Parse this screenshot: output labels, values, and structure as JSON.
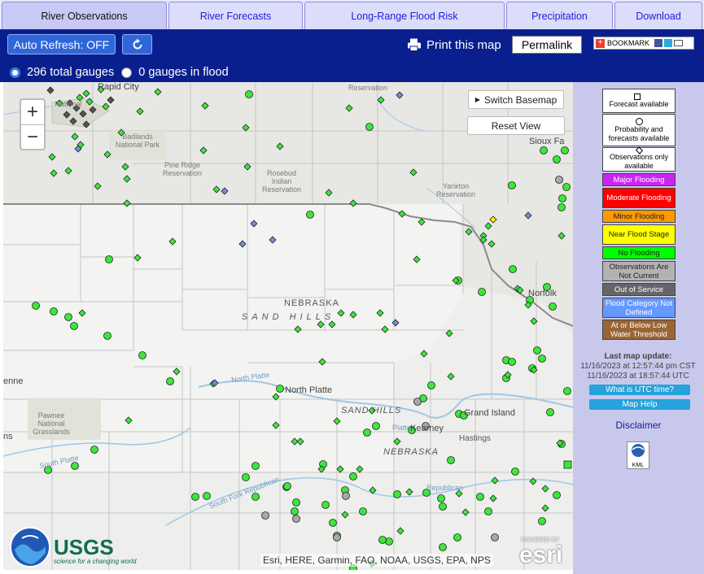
{
  "tabs": [
    {
      "label": "River Observations",
      "active": true
    },
    {
      "label": "River Forecasts",
      "active": false
    },
    {
      "label": "Long-Range Flood Risk",
      "active": false
    },
    {
      "label": "Precipitation",
      "active": false
    },
    {
      "label": "Download",
      "active": false
    }
  ],
  "toolbar": {
    "auto_refresh": "Auto Refresh: OFF",
    "refresh_icon": "refresh-icon",
    "print": "Print this map",
    "permalink": "Permalink",
    "bookmark": "BOOKMARK"
  },
  "gauges": {
    "total": "296 total gauges",
    "in_flood": "0 gauges in flood"
  },
  "map": {
    "zoom_in": "+",
    "zoom_out": "−",
    "switch_basemap": "Switch Basemap",
    "reset_view": "Reset View",
    "attribution": "Esri, HERE, Garmin, FAO, NOAA, USGS, EPA, NPS",
    "esri": "esri",
    "esri_powered": "POWERED BY",
    "usgs": "USGS",
    "usgs_tagline": "science for a changing world",
    "labels": {
      "rapid_city": "Rapid City",
      "badlands": "Badlands National Park",
      "pine_ridge": "Pine Ridge Reservation",
      "rosebud": "Rosebud Indian Reservation",
      "yankton": "Yankton Reservation",
      "reservation": "Reservation",
      "sioux_falls": "Sioux Fa",
      "nebraska": "NEBRASKA",
      "sand_hills": "SAND HILLS",
      "sand_hills2": "SAND HILLS",
      "north_platte": "North Platte",
      "north_platte_river": "North Platte",
      "south_platte": "South Platte",
      "republican": "South Fork Republican",
      "republican2": "Republican",
      "grand_island": "Grand Island",
      "kearney": "Kearney",
      "hastings": "Hastings",
      "nebraska2": "NEBRASKA",
      "norfolk": "Norfolk",
      "pawnee": "Pawnee National Grasslands",
      "cheyenne": "enne",
      "ns": "ns",
      "platte": "Platte",
      "national": "National"
    },
    "colors": {
      "no_flood": "#39e939",
      "obs_only": "#6f8fd0",
      "not_current": "#a8a8a8",
      "near_flood": "#f5f500",
      "out_of_service": "#5a5a5a"
    }
  },
  "legend": {
    "forecast": "Forecast available",
    "probability": "Probability and forecasts available",
    "observations_only": "Observations only available",
    "major": "Major Flooding",
    "moderate": "Moderate Flooding",
    "minor": "Minor Flooding",
    "near": "Near Flood Stage",
    "no_flooding": "No Flooding",
    "not_current": "Observations Are Not Current",
    "out_of_service": "Out of Service",
    "not_defined": "Flood Category Not Defined",
    "low_water": "At or Below Low Water Threshold",
    "colors": {
      "major": "#c926f1",
      "moderate": "#ff0000",
      "minor": "#ff9900",
      "near": "#ffff00",
      "no_flooding": "#00ff00",
      "not_current": "#b2b2b2",
      "out_of_service": "#666666",
      "not_defined": "#6699ff",
      "low_water": "#996633"
    },
    "last_update_label": "Last map update:",
    "last_update_cst": "11/16/2023 at 12:57:44 pm CST",
    "last_update_utc": "11/16/2023 at 18:57:44 UTC",
    "utc_button": "What is UTC time?",
    "map_help": "Map Help",
    "disclaimer": "Disclaimer",
    "kml": "KML"
  }
}
